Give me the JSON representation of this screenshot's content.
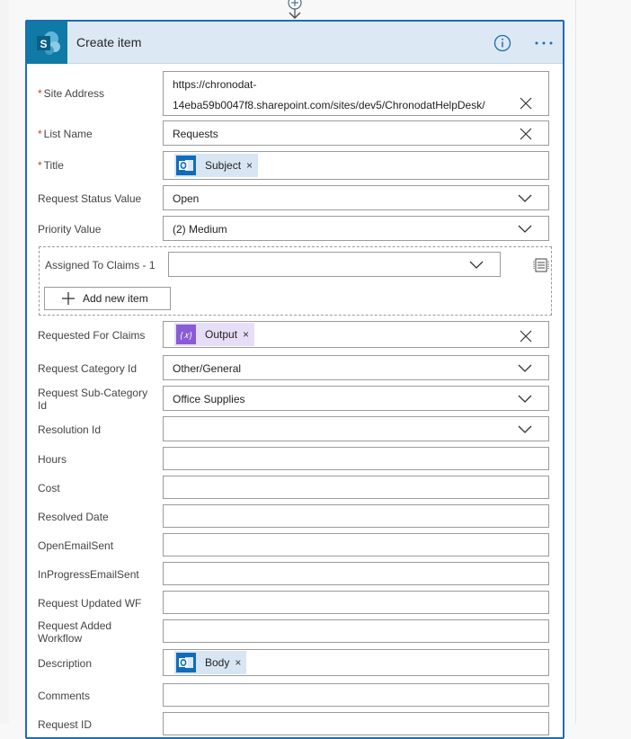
{
  "card": {
    "title": "Create item",
    "icon": "sharepoint-icon",
    "accent_color": "#1f6bb8",
    "header_color": "#dce8f4"
  },
  "fields": {
    "site_address": {
      "label": "Site Address",
      "required": "*",
      "value_line1": "https://chronodat-",
      "value_line2": "14eba59b0047f8.sharepoint.com/sites/dev5/ChronodatHelpDesk/"
    },
    "list_name": {
      "label": "List Name",
      "required": "*",
      "value": "Requests"
    },
    "title": {
      "label": "Title",
      "required": "*",
      "token": "Subject"
    },
    "request_status": {
      "label": "Request Status Value",
      "value": "Open"
    },
    "priority": {
      "label": "Priority Value",
      "value": "(2) Medium"
    },
    "assigned_to": {
      "label": "Assigned To Claims - 1",
      "value": "",
      "add_label": "Add new item"
    },
    "requested_for": {
      "label": "Requested For Claims",
      "token": "Output"
    },
    "request_category": {
      "label": "Request Category Id",
      "value": "Other/General"
    },
    "request_subcategory": {
      "label_line1": "Request Sub-Category",
      "label_line2": "Id",
      "value": "Office Supplies"
    },
    "resolution": {
      "label": "Resolution Id",
      "value": ""
    },
    "hours": {
      "label": "Hours",
      "value": ""
    },
    "cost": {
      "label": "Cost",
      "value": ""
    },
    "resolved_date": {
      "label": "Resolved Date",
      "value": ""
    },
    "open_email_sent": {
      "label": "OpenEmailSent",
      "value": ""
    },
    "in_progress_email_sent": {
      "label": "InProgressEmailSent",
      "value": ""
    },
    "request_updated_wf": {
      "label": "Request Updated WF",
      "value": ""
    },
    "request_added_workflow": {
      "label_line1": "Request Added",
      "label_line2": "Workflow",
      "value": ""
    },
    "description": {
      "label": "Description",
      "token": "Body"
    },
    "comments": {
      "label": "Comments",
      "value": ""
    },
    "request_id": {
      "label": "Request ID",
      "value": ""
    }
  },
  "token_close": "×"
}
